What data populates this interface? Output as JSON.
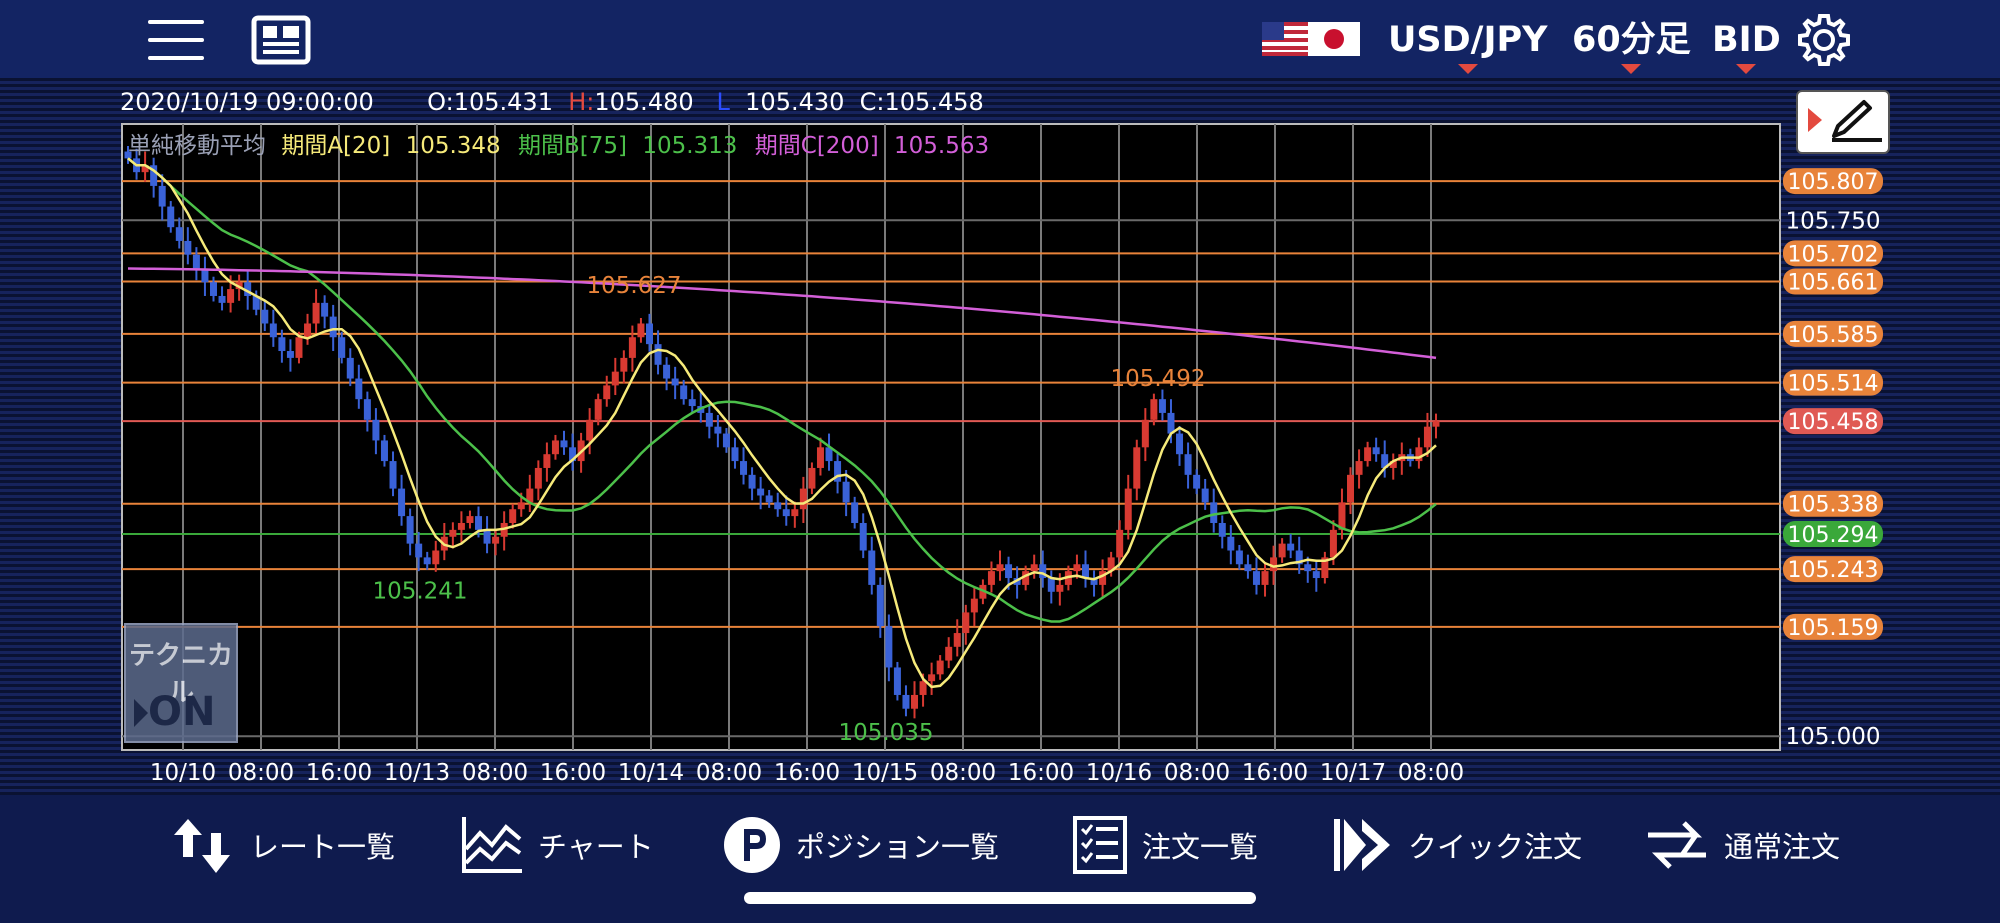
{
  "topbar": {
    "symbol": "USD/JPY",
    "timeframe": "60分足",
    "price_side": "BID"
  },
  "ohlc": {
    "datetime": "2020/10/19 09:00:00",
    "open_label": "O:",
    "open": "105.431",
    "high_label": "H:",
    "high": "105.480",
    "low_label": "L",
    "low": "105.430",
    "close_label": "C:",
    "close": "105.458"
  },
  "indicator": {
    "name": "単純移動平均",
    "a_label": "期間A[20]",
    "a_value": "105.348",
    "b_label": "期間B[75]",
    "b_value": "105.313",
    "c_label": "期間C[200]",
    "c_value": "105.563"
  },
  "chart_data": {
    "type": "candlestick",
    "ylim": [
      104.98,
      105.89
    ],
    "y_ticks": [
      "105.750",
      "105.000"
    ],
    "x_ticks": [
      "10/10",
      "08:00",
      "16:00",
      "10/13",
      "08:00",
      "16:00",
      "10/14",
      "08:00",
      "16:00",
      "10/15",
      "08:00",
      "16:00",
      "10/16",
      "08:00",
      "16:00",
      "10/17",
      "08:00"
    ],
    "annotations": [
      {
        "text": "105.627",
        "value": 105.627
      },
      {
        "text": "105.492",
        "value": 105.492
      },
      {
        "text": "105.241",
        "value": 105.241
      },
      {
        "text": "105.035",
        "value": 105.035
      }
    ],
    "price_lines": [
      {
        "text": "105.807",
        "value": 105.807,
        "color": "#e8833a"
      },
      {
        "text": "105.702",
        "value": 105.702,
        "color": "#e8833a"
      },
      {
        "text": "105.661",
        "value": 105.661,
        "color": "#e8833a"
      },
      {
        "text": "105.585",
        "value": 105.585,
        "color": "#e8833a"
      },
      {
        "text": "105.514",
        "value": 105.514,
        "color": "#e8833a"
      },
      {
        "text": "105.458",
        "value": 105.458,
        "color": "#e05a54"
      },
      {
        "text": "105.338",
        "value": 105.338,
        "color": "#e8833a"
      },
      {
        "text": "105.294",
        "value": 105.294,
        "color": "#3aa83a"
      },
      {
        "text": "105.243",
        "value": 105.243,
        "color": "#e8833a"
      },
      {
        "text": "105.159",
        "value": 105.159,
        "color": "#e8833a"
      }
    ],
    "series_close": [
      105.84,
      105.82,
      105.83,
      105.8,
      105.77,
      105.74,
      105.72,
      105.7,
      105.68,
      105.66,
      105.64,
      105.63,
      105.65,
      105.66,
      105.64,
      105.62,
      105.6,
      105.58,
      105.56,
      105.55,
      105.58,
      105.6,
      105.63,
      105.61,
      105.58,
      105.55,
      105.52,
      105.49,
      105.46,
      105.43,
      105.4,
      105.36,
      105.32,
      105.28,
      105.26,
      105.25,
      105.27,
      105.29,
      105.3,
      105.31,
      105.32,
      105.3,
      105.28,
      105.29,
      105.31,
      105.33,
      105.34,
      105.36,
      105.39,
      105.41,
      105.43,
      105.42,
      105.4,
      105.43,
      105.46,
      105.49,
      105.51,
      105.53,
      105.55,
      105.58,
      105.6,
      105.57,
      105.54,
      105.52,
      105.51,
      105.49,
      105.48,
      105.47,
      105.45,
      105.44,
      105.42,
      105.4,
      105.38,
      105.36,
      105.35,
      105.34,
      105.33,
      105.32,
      105.33,
      105.36,
      105.39,
      105.42,
      105.4,
      105.37,
      105.34,
      105.31,
      105.27,
      105.22,
      105.16,
      105.1,
      105.06,
      105.04,
      105.06,
      105.08,
      105.09,
      105.11,
      105.13,
      105.15,
      105.18,
      105.2,
      105.22,
      105.24,
      105.25,
      105.23,
      105.22,
      105.24,
      105.25,
      105.23,
      105.21,
      105.22,
      105.24,
      105.25,
      105.23,
      105.22,
      105.24,
      105.26,
      105.3,
      105.36,
      105.42,
      105.46,
      105.49,
      105.47,
      105.44,
      105.41,
      105.38,
      105.36,
      105.34,
      105.31,
      105.29,
      105.27,
      105.25,
      105.24,
      105.22,
      105.24,
      105.26,
      105.28,
      105.27,
      105.25,
      105.24,
      105.23,
      105.26,
      105.3,
      105.34,
      105.38,
      105.4,
      105.42,
      105.41,
      105.39,
      105.4,
      105.41,
      105.4,
      105.42,
      105.45,
      105.458
    ]
  },
  "tech_button": {
    "label": "テクニカル",
    "state": "ON"
  },
  "nav": {
    "rate_list": "レート一覧",
    "chart": "チャート",
    "positions": "ポジション一覧",
    "orders": "注文一覧",
    "quick_order": "クイック注文",
    "normal_order": "通常注文"
  },
  "colors": {
    "accent_red": "#e34a3f",
    "ma_a": "#f6ea7a",
    "ma_b": "#4cc04a",
    "ma_c": "#d35fd8",
    "price_line": "#e8833a",
    "candle_up": "#d83a32",
    "candle_down": "#3a62d8"
  }
}
